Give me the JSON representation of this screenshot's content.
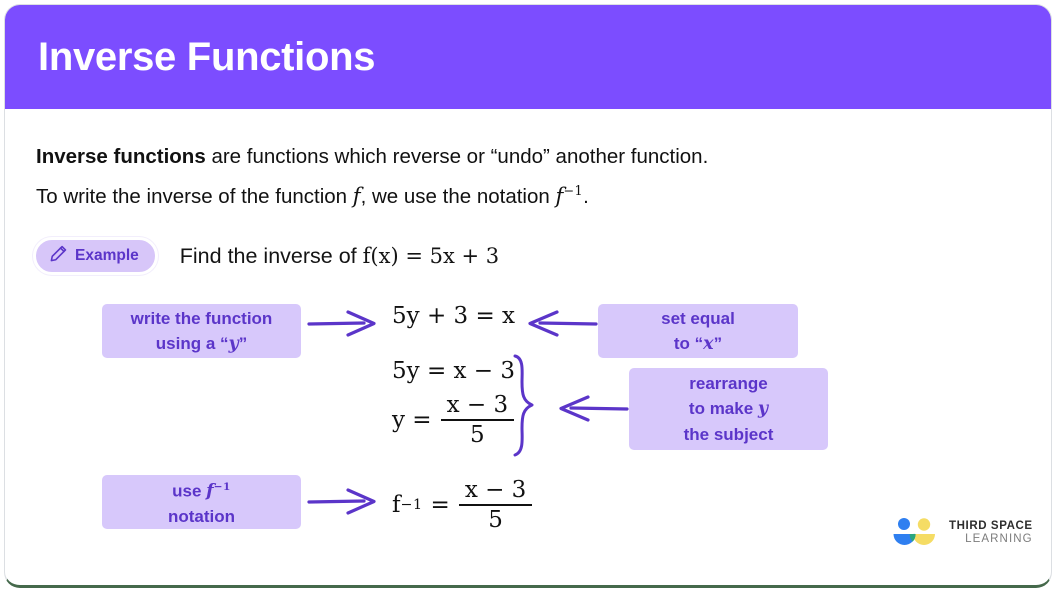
{
  "header": {
    "title": "Inverse Functions",
    "bg_color": "#7c4dff"
  },
  "body": {
    "line1_bold": "Inverse functions",
    "line1_rest": " are functions which reverse or “undo” another function.",
    "line2_a": "To write the inverse of the function ",
    "line2_f": "f",
    "line2_b": ", we use the notation ",
    "line2_finv": "f",
    "line2_finv_sup": "−1",
    "line2_c": "."
  },
  "example": {
    "badge_label": "Example",
    "badge_icon": "pencil-icon",
    "prompt": "Find the inverse of",
    "function": "f(x) = 5x + 3"
  },
  "diagram": {
    "notes": [
      {
        "id": "write-function",
        "line1": "write the function",
        "line2_a": "using a “",
        "line2_math": "y",
        "line2_b": "”"
      },
      {
        "id": "set-equal",
        "line1": "set equal",
        "line2_a": "to “",
        "line2_math": "x",
        "line2_b": "”"
      },
      {
        "id": "rearrange",
        "line1": "rearrange",
        "line2_a": "to make ",
        "line2_math": "y",
        "line3": "the subject"
      },
      {
        "id": "use-notation",
        "line1_a": "use ",
        "line1_math": "f",
        "line1_sup": "−1",
        "line2": "notation"
      }
    ],
    "equations": {
      "eq1": "5y + 3 = x",
      "eq2": "5y = x − 3",
      "eq3_lhs": "y =",
      "eq3_num": "x − 3",
      "eq3_den": "5",
      "eq4_lhs": "f",
      "eq4_lhs_sup": "−1",
      "eq4_eq": "=",
      "eq4_num": "x − 3",
      "eq4_den": "5"
    },
    "accent_color": "#5b35c9",
    "note_bg_color": "#d7c8fb"
  },
  "logo": {
    "line1": "THIRD SPACE",
    "line2": "LEARNING",
    "blue": "#2f7ff0",
    "yellow": "#f5dc64",
    "teal": "#2aa57e"
  }
}
